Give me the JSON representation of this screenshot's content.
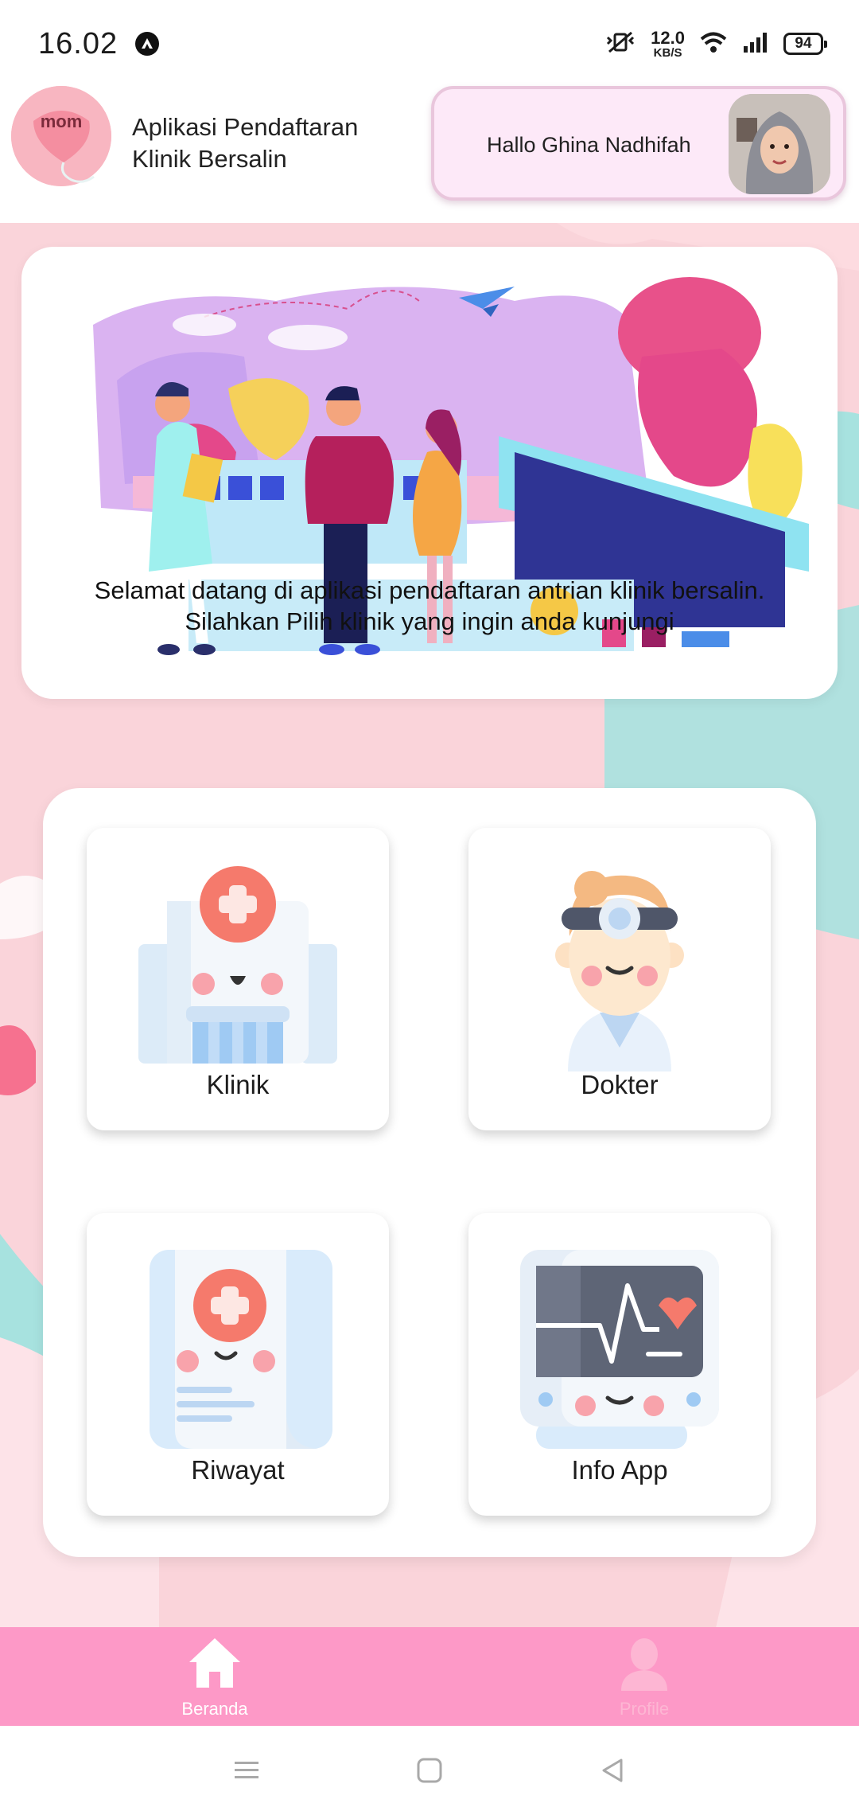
{
  "status_bar": {
    "time": "16.02",
    "net_speed_value": "12.0",
    "net_speed_unit": "KB/S",
    "battery": "94"
  },
  "header": {
    "logo_text": "mom",
    "app_title": "Aplikasi Pendaftaran Klinik Bersalin",
    "greeting": "Hallo Ghina Nadhifah"
  },
  "banner": {
    "line1": "Selamat datang di aplikasi pendaftaran antrian klinik bersalin.",
    "line2": "Silahkan Pilih klinik yang ingin anda kunjungi"
  },
  "menu": {
    "items": [
      {
        "label": "Klinik",
        "icon": "hospital-icon"
      },
      {
        "label": "Dokter",
        "icon": "doctor-icon"
      },
      {
        "label": "Riwayat",
        "icon": "medical-record-icon"
      },
      {
        "label": "Info App",
        "icon": "heart-monitor-icon"
      }
    ]
  },
  "bottom_nav": {
    "items": [
      {
        "label": "Beranda",
        "icon": "home-icon",
        "active": true
      },
      {
        "label": "Profile",
        "icon": "person-icon",
        "active": false
      }
    ]
  },
  "colors": {
    "nav_bg": "#fd99c7",
    "greeting_bg": "#fde9f8",
    "logo_bg": "#f8b6c1",
    "accent_red": "#f57a6c"
  }
}
